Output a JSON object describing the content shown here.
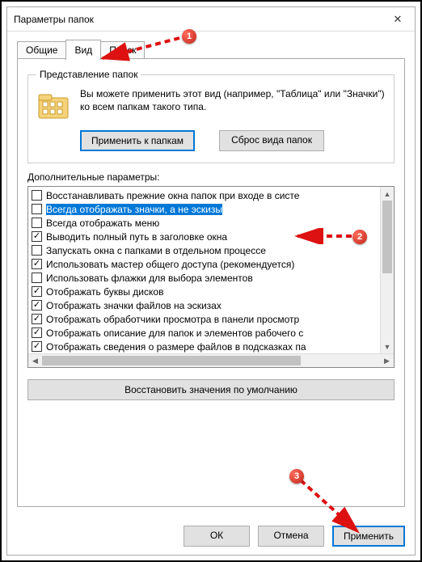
{
  "window": {
    "title": "Параметры папок"
  },
  "tabs": {
    "general": "Общие",
    "view": "Вид",
    "search": "Поиск"
  },
  "folder_views": {
    "legend": "Представление папок",
    "description": "Вы можете применить этот вид (например, \"Таблица\" или \"Значки\") ко всем папкам такого типа.",
    "apply_button": "Применить к папкам",
    "reset_button": "Сброс вида папок"
  },
  "advanced": {
    "label": "Дополнительные параметры:",
    "items": [
      {
        "checked": false,
        "label": "Восстанавливать прежние окна папок при входе в систе"
      },
      {
        "checked": false,
        "label": "Всегда отображать значки, а не эскизы",
        "selected": true
      },
      {
        "checked": false,
        "label": "Всегда отображать меню"
      },
      {
        "checked": true,
        "label": "Выводить полный путь в заголовке окна"
      },
      {
        "checked": false,
        "label": "Запускать окна с папками в отдельном процессе"
      },
      {
        "checked": true,
        "label": "Использовать мастер общего доступа (рекомендуется)"
      },
      {
        "checked": false,
        "label": "Использовать флажки для выбора элементов"
      },
      {
        "checked": true,
        "label": "Отображать буквы дисков"
      },
      {
        "checked": true,
        "label": "Отображать значки файлов на эскизах"
      },
      {
        "checked": true,
        "label": "Отображать обработчики просмотра в панели просмотр"
      },
      {
        "checked": true,
        "label": "Отображать описание для папок и элементов рабочего с"
      },
      {
        "checked": true,
        "label": "Отображать сведения о размере файлов в подсказках па"
      }
    ],
    "restore_defaults": "Восстановить значения по умолчанию"
  },
  "buttons": {
    "ok": "ОК",
    "cancel": "Отмена",
    "apply": "Применить"
  },
  "annotations": {
    "b1": "1",
    "b2": "2",
    "b3": "3"
  }
}
